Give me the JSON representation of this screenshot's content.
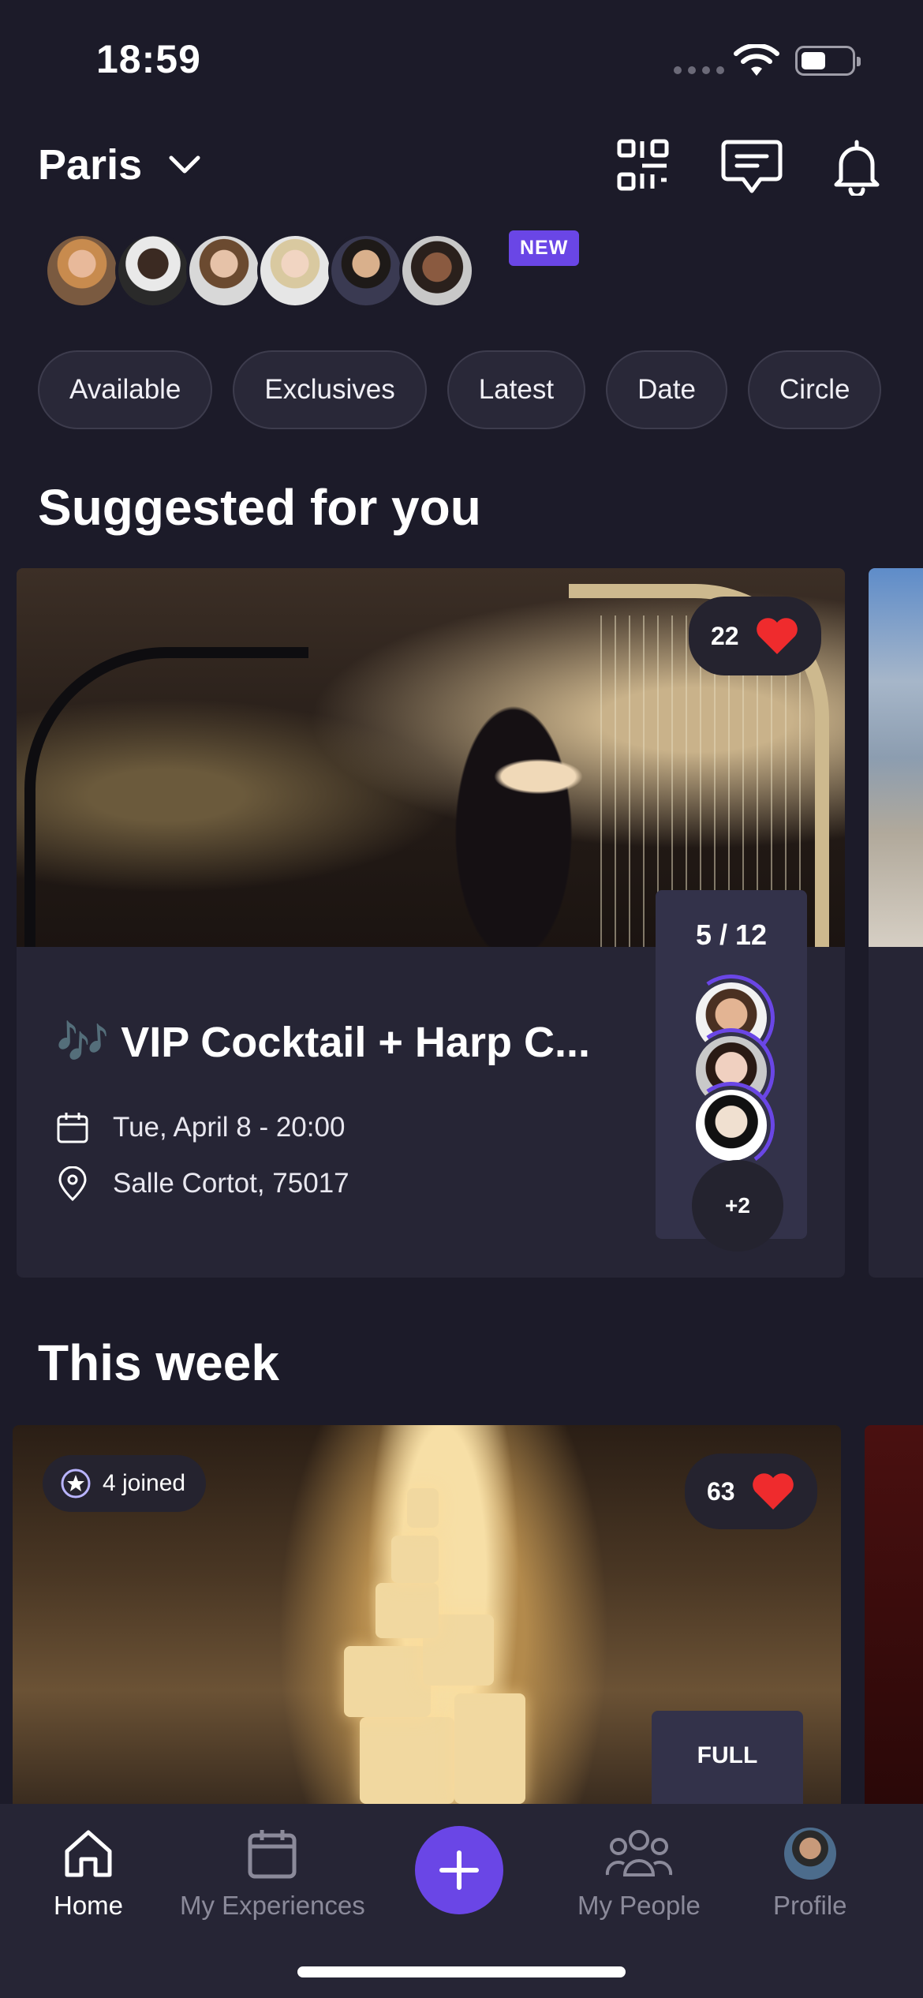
{
  "status_bar": {
    "time": "18:59"
  },
  "header": {
    "city": "Paris",
    "new_badge": "NEW"
  },
  "avatars": [
    "avatar-1",
    "avatar-2",
    "avatar-3",
    "avatar-4",
    "avatar-5",
    "avatar-6"
  ],
  "filters": [
    "Available",
    "Exclusives",
    "Latest",
    "Date",
    "Circle"
  ],
  "sections": {
    "suggested": "Suggested for you",
    "this_week": "This week"
  },
  "suggested_card": {
    "title": "🎶 VIP Cocktail + Harp C...",
    "likes": "22",
    "date": "Tue, April 8 - 20:00",
    "location": "Salle Cortot, 75017",
    "attendance": "5 / 12",
    "more_attendees": "+2"
  },
  "week_card": {
    "joined": "4 joined",
    "likes": "63",
    "status": "FULL"
  },
  "tabs": {
    "home": "Home",
    "experiences": "My Experiences",
    "people": "My People",
    "profile": "Profile"
  },
  "colors": {
    "accent": "#6a46e6",
    "heart": "#ef2b2d",
    "background": "#1c1b29",
    "card": "#262535"
  }
}
